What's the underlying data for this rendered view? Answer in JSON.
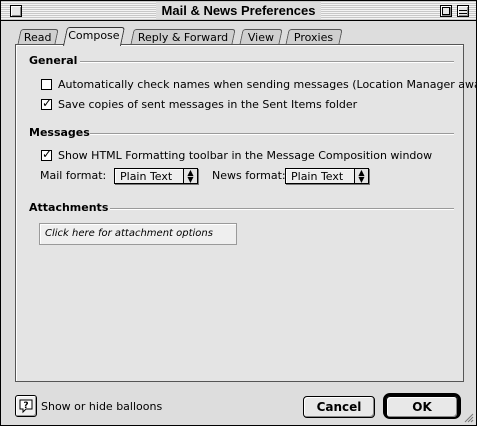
{
  "window": {
    "title": "Mail & News Preferences"
  },
  "tabs": [
    {
      "label": "Read"
    },
    {
      "label": "Compose"
    },
    {
      "label": "Reply & Forward"
    },
    {
      "label": "View"
    },
    {
      "label": "Proxies"
    }
  ],
  "active_tab": "Compose",
  "general": {
    "title": "General",
    "check_names": {
      "label": "Automatically check names when sending messages (Location Manager aware)",
      "checked": false
    },
    "save_copies": {
      "label": "Save copies of sent messages in the Sent Items folder",
      "checked": true
    }
  },
  "messages": {
    "title": "Messages",
    "html_toolbar": {
      "label": "Show HTML Formatting toolbar in the Message Composition window",
      "checked": true
    },
    "mail_format_label": "Mail format:",
    "mail_format_value": "Plain Text",
    "news_format_label": "News format:",
    "news_format_value": "Plain Text"
  },
  "attachments": {
    "title": "Attachments",
    "button_label": "Click here for attachment options"
  },
  "footer": {
    "help_label": "Show or hide balloons",
    "cancel_label": "Cancel",
    "ok_label": "OK"
  }
}
